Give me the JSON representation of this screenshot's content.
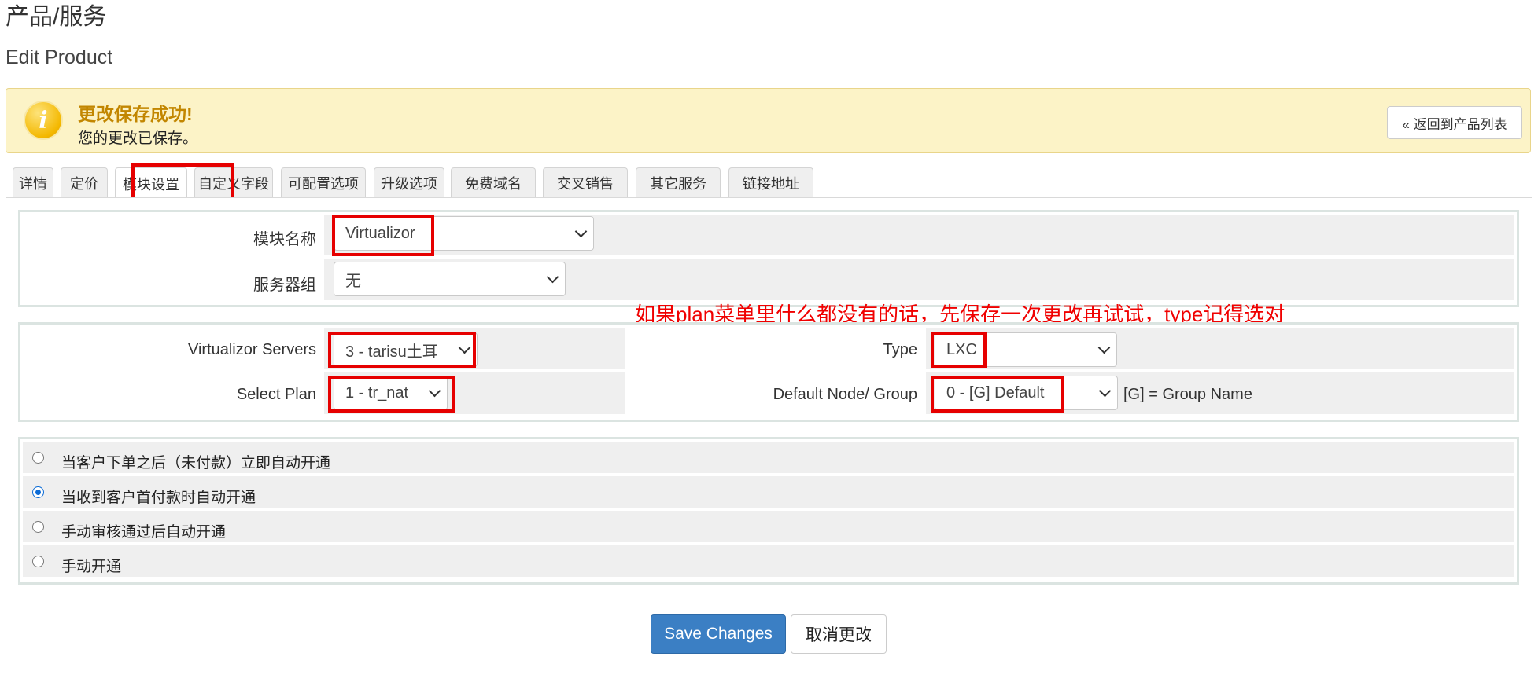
{
  "page": {
    "title": "产品/服务",
    "subtitle": "Edit Product"
  },
  "alert": {
    "title": "更改保存成功!",
    "message": "您的更改已保存。",
    "back_button": "« 返回到产品列表",
    "icon": "info-icon",
    "icon_glyph": "i"
  },
  "tabs": [
    {
      "label": "详情"
    },
    {
      "label": "定价"
    },
    {
      "label": "模块设置",
      "active": true
    },
    {
      "label": "自定义字段"
    },
    {
      "label": "可配置选项"
    },
    {
      "label": "升级选项"
    },
    {
      "label": "免费域名"
    },
    {
      "label": "交叉销售"
    },
    {
      "label": "其它服务"
    },
    {
      "label": "链接地址"
    }
  ],
  "module": {
    "module_name_label": "模块名称",
    "module_name_value": "Virtualizor",
    "server_group_label": "服务器组",
    "server_group_value": "无"
  },
  "config": {
    "servers_label": "Virtualizor Servers",
    "servers_value": "3 - tarisu土耳",
    "plan_label": "Select Plan",
    "plan_value": "1 - tr_nat",
    "type_label": "Type",
    "type_value": "LXC",
    "node_label": "Default Node/ Group",
    "node_value": "0 - [G] Default",
    "node_hint": "[G] = Group Name"
  },
  "annotation": {
    "note": "如果plan菜单里什么都没有的话，先保存一次更改再试试，type记得选对",
    "color": "#e60000"
  },
  "provisioning": {
    "options": [
      {
        "label": "当客户下单之后（未付款）立即自动开通",
        "checked": false
      },
      {
        "label": "当收到客户首付款时自动开通",
        "checked": true
      },
      {
        "label": "手动审核通过后自动开通",
        "checked": false
      },
      {
        "label": "手动开通",
        "checked": false
      }
    ]
  },
  "actions": {
    "save": "Save Changes",
    "cancel": "取消更改"
  },
  "colors": {
    "primary": "#3b7fc4",
    "alert_bg": "#fcf3c7",
    "alert_title": "#c28600"
  }
}
